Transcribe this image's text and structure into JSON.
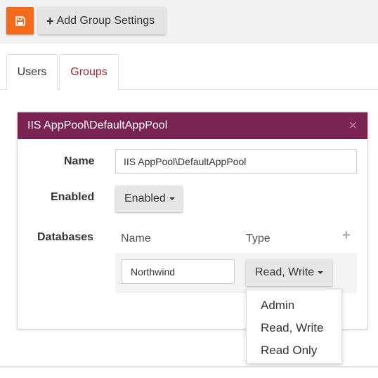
{
  "toolbar": {
    "save_icon": "floppy-disk-icon",
    "save_color": "#f26a1b",
    "add_group_label": "Add Group Settings",
    "add_group_icon": "+"
  },
  "tabs": [
    {
      "label": "Users",
      "active": false
    },
    {
      "label": "Groups",
      "active": true
    }
  ],
  "panel": {
    "title": "IIS AppPool\\DefaultAppPool",
    "header_color": "#7a2352",
    "close_icon": "close-icon",
    "name_label": "Name",
    "name_value": "IIS AppPool\\DefaultAppPool",
    "enabled_label": "Enabled",
    "enabled_value": "Enabled",
    "databases_label": "Databases",
    "db_columns": {
      "name": "Name",
      "type": "Type"
    },
    "db_add_icon": "+",
    "db_rows": [
      {
        "name": "Northwind",
        "type": "Read, Write"
      }
    ],
    "type_options": [
      "Admin",
      "Read, Write",
      "Read Only"
    ]
  }
}
